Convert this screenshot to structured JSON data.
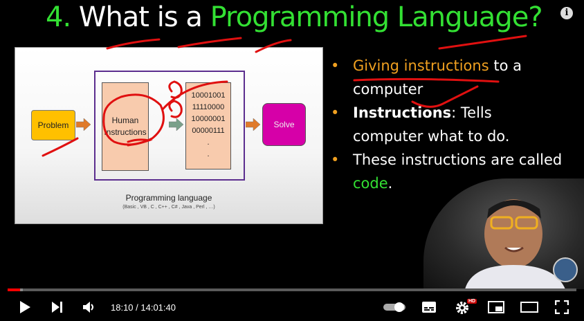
{
  "header": {
    "title_number": "4.",
    "title_white": "What is a",
    "title_green": "Programming Language?",
    "info_icon": "info-icon"
  },
  "slide": {
    "problem_label": "Problem",
    "human_label_line1": "Human",
    "human_label_line2": "Instructions",
    "binary_lines": [
      "10001001",
      "11110000",
      "10000001",
      "00000111",
      ".",
      "."
    ],
    "solve_label": "Solve",
    "caption": "Programming language",
    "subcaption": "(Basic , VB , C , C++ , C# , Java , Perl , …)"
  },
  "bullets": {
    "b1_highlight": "Giving instructions",
    "b1_rest": " to a computer",
    "b2_highlight": "Instructions",
    "b2_rest": ": Tells computer what to do.",
    "b3_start": "These instructions are called ",
    "b3_highlight": "code",
    "b3_end": "."
  },
  "player": {
    "time_display": "18:10 / 14:01:40",
    "progress_fraction": 0.0216,
    "hd_badge": "HD",
    "icons": [
      "play-icon",
      "next-icon",
      "volume-icon",
      "autoplay-toggle-icon",
      "subtitles-icon",
      "settings-icon",
      "miniplayer-icon",
      "theater-mode-icon",
      "fullscreen-icon"
    ]
  },
  "colors": {
    "title_green": "#33e033",
    "bullet_orange": "#f0a020",
    "progress_red": "#ff0000"
  }
}
